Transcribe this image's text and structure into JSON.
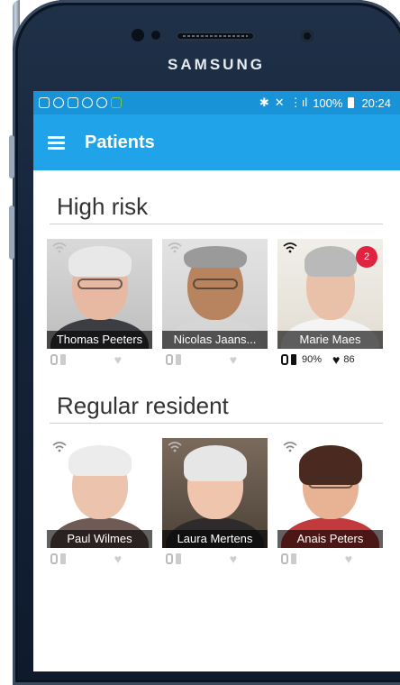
{
  "device": {
    "brand": "SAMSUNG"
  },
  "status_bar": {
    "battery": "100%",
    "time": "20:24"
  },
  "app_bar": {
    "title": "Patients",
    "menu_icon": "menu-icon"
  },
  "sections": [
    {
      "title": "High risk",
      "patients": [
        {
          "name": "Thomas Peeters",
          "wifi": "wifi-icon",
          "active": false
        },
        {
          "name": "Nicolas Jaans...",
          "wifi": "wifi-icon",
          "active": false
        },
        {
          "name": "Marie Maes",
          "wifi": "wifi-icon",
          "active": true,
          "badge": "2",
          "battery": "90%",
          "heart_rate": "86"
        }
      ]
    },
    {
      "title": "Regular resident",
      "patients": [
        {
          "name": "Paul Wilmes",
          "wifi": "wifi-icon",
          "active": false
        },
        {
          "name": "Laura Mertens",
          "wifi": "wifi-icon",
          "active": false
        },
        {
          "name": "Anais Peters",
          "wifi": "wifi-icon",
          "active": false
        }
      ]
    }
  ],
  "colors": {
    "status_bar": "#1993d8",
    "app_bar": "#21a3ea",
    "badge": "#e0243f"
  }
}
